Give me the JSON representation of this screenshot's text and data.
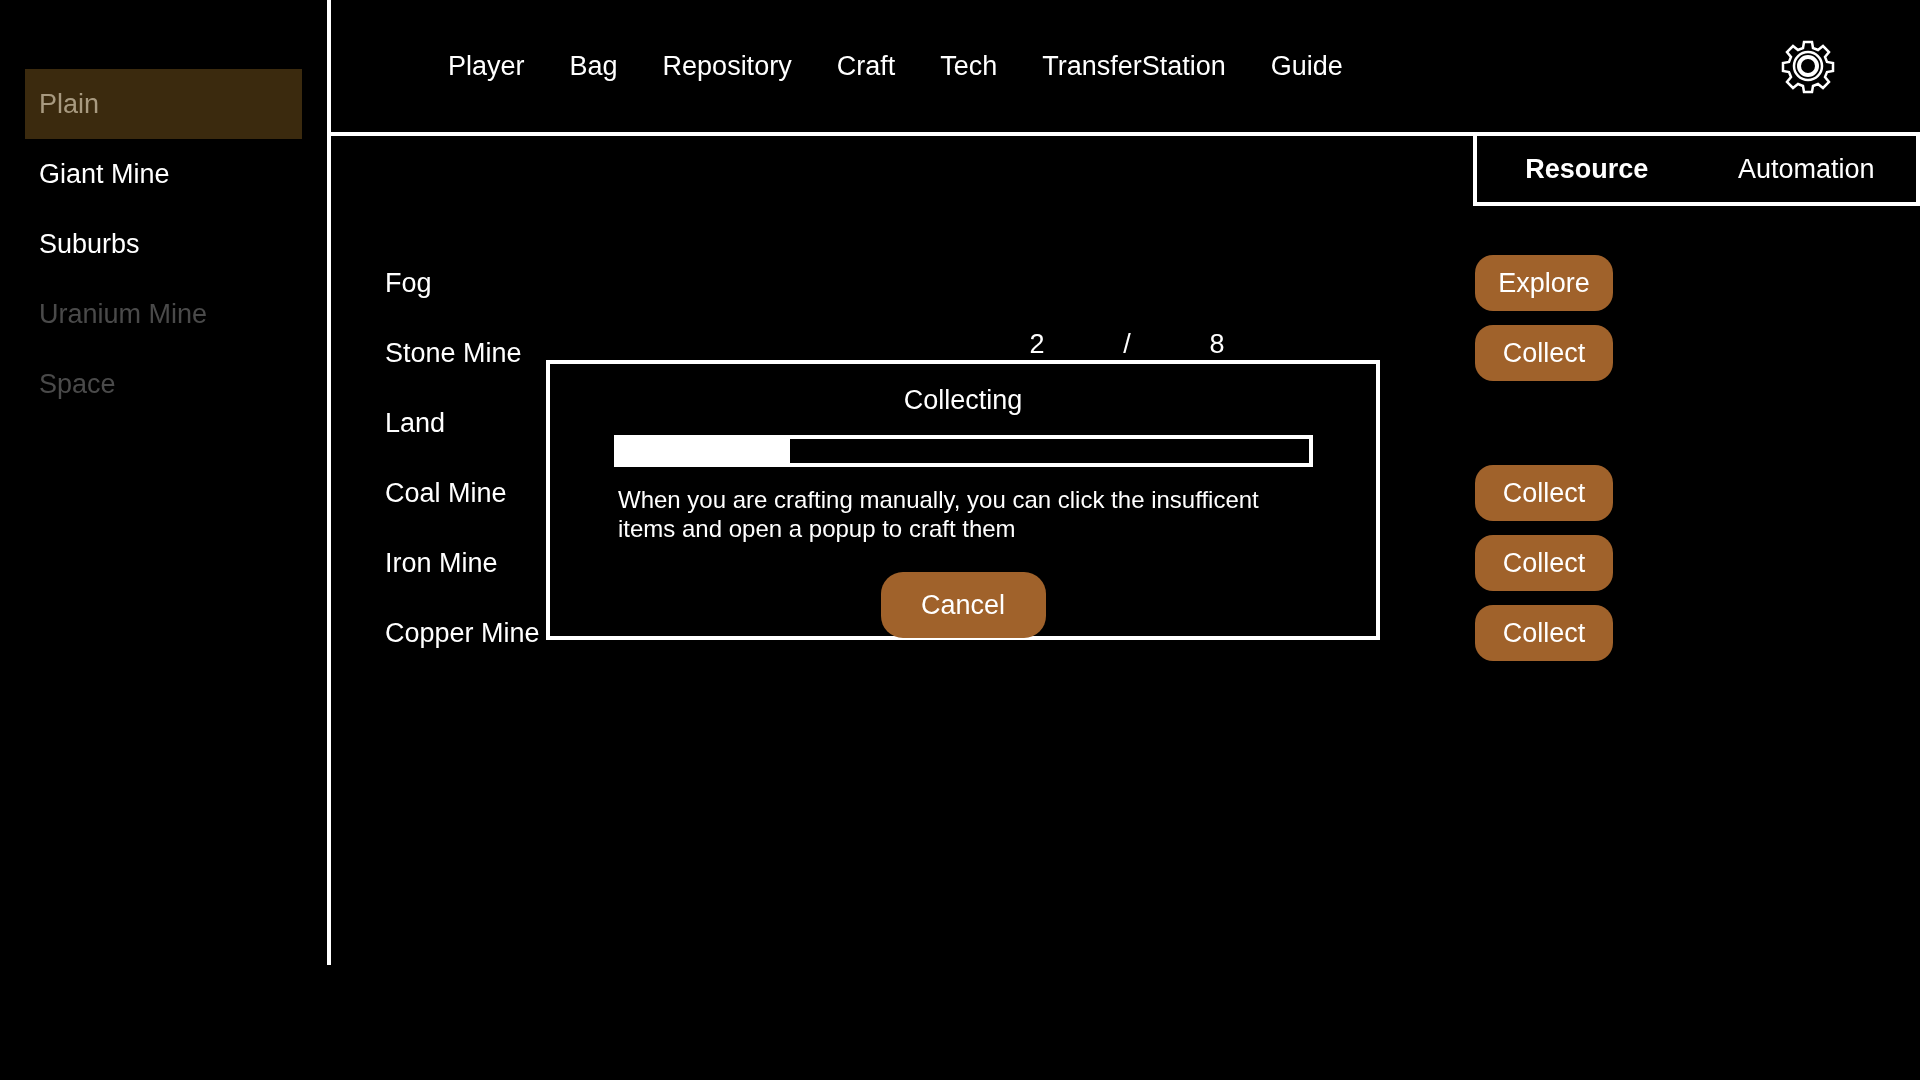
{
  "sidebar": {
    "items": [
      {
        "label": "Plain",
        "selected": true,
        "locked": false
      },
      {
        "label": "Giant Mine",
        "selected": false,
        "locked": false
      },
      {
        "label": "Suburbs",
        "selected": false,
        "locked": false
      },
      {
        "label": "Uranium Mine",
        "selected": false,
        "locked": true
      },
      {
        "label": "Space",
        "selected": false,
        "locked": true
      }
    ]
  },
  "nav": {
    "items": [
      "Player",
      "Bag",
      "Repository",
      "Craft",
      "Tech",
      "TransferStation",
      "Guide"
    ]
  },
  "tabs": [
    {
      "label": "Resource",
      "selected": true
    },
    {
      "label": "Automation",
      "selected": false
    }
  ],
  "resources": [
    {
      "name": "Fog",
      "action": "Explore"
    },
    {
      "name": "Stone Mine",
      "count": [
        "2",
        "/",
        "8"
      ],
      "action": "Collect"
    },
    {
      "name": "Land"
    },
    {
      "name": "Coal Mine",
      "action": "Collect"
    },
    {
      "name": "Iron Mine",
      "action": "Collect"
    },
    {
      "name": "Copper Mine",
      "action": "Collect"
    }
  ],
  "popup": {
    "title": "Collecting",
    "level": 0.25,
    "message": "When you are crafting manually, you can click the insufficent items and open a popup to craft them",
    "button": "Cancel"
  }
}
